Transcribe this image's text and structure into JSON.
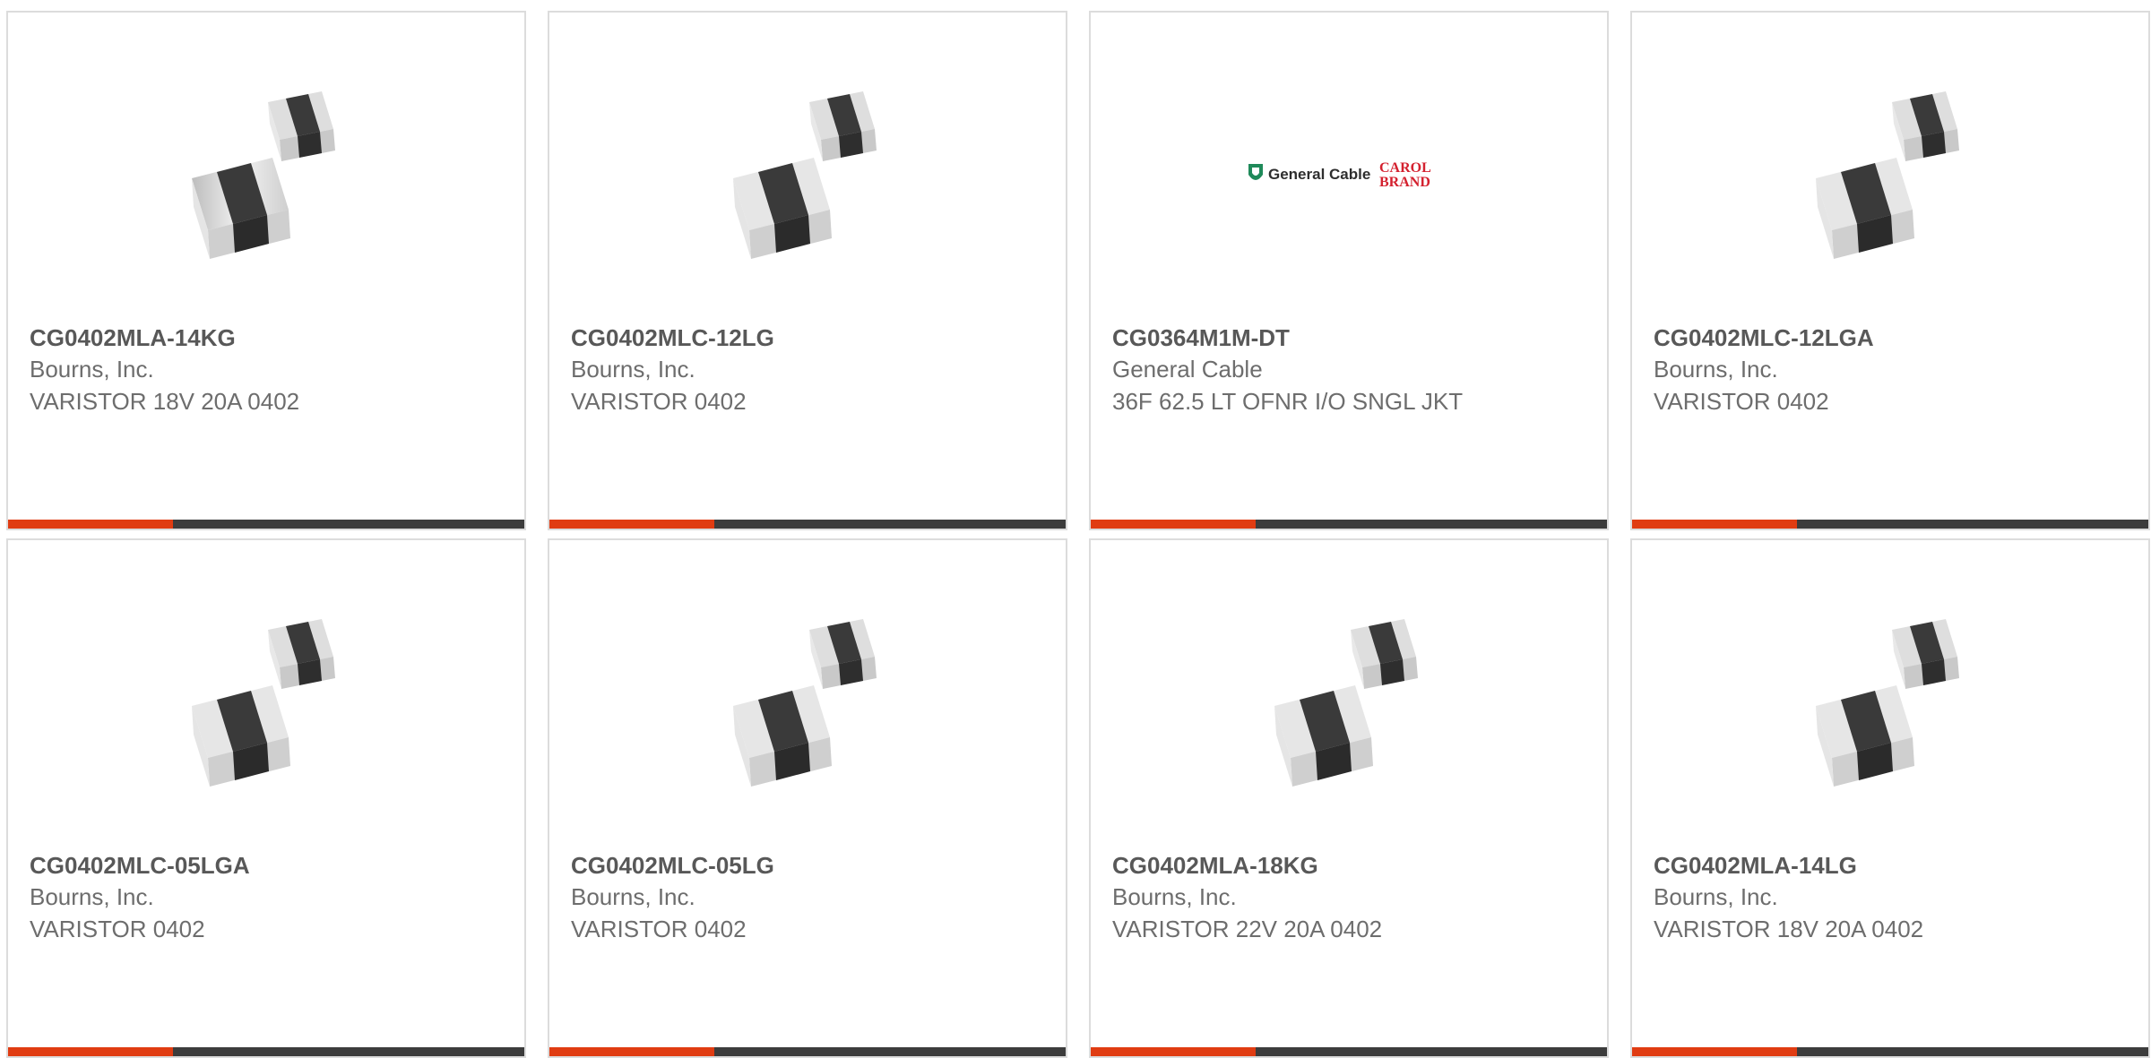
{
  "colors": {
    "accent": "#e03c12",
    "bar": "#3c3c3c",
    "border": "#dcdcdc",
    "part_text": "#585858",
    "body_text": "#6d6d6d"
  },
  "products": [
    {
      "part": "CG0402MLA-14KG",
      "manufacturer": "Bourns, Inc.",
      "description": "VARISTOR 18V 20A 0402",
      "image": "smd-chip-icon"
    },
    {
      "part": "CG0402MLC-12LG",
      "manufacturer": "Bourns, Inc.",
      "description": "VARISTOR 0402",
      "image": "smd-chip-icon"
    },
    {
      "part": "CG0364M1M-DT",
      "manufacturer": "General Cable",
      "description": "36F 62.5 LT OFNR I/O SNGL JKT",
      "image": "general-cable-logo",
      "logo_text": "General Cable",
      "brand_line1": "CAROL",
      "brand_line2": "BRAND"
    },
    {
      "part": "CG0402MLC-12LGA",
      "manufacturer": "Bourns, Inc.",
      "description": "VARISTOR 0402",
      "image": "smd-chip-icon"
    },
    {
      "part": "CG0402MLC-05LGA",
      "manufacturer": "Bourns, Inc.",
      "description": "VARISTOR 0402",
      "image": "smd-chip-icon"
    },
    {
      "part": "CG0402MLC-05LG",
      "manufacturer": "Bourns, Inc.",
      "description": "VARISTOR 0402",
      "image": "smd-chip-icon"
    },
    {
      "part": "CG0402MLA-18KG",
      "manufacturer": "Bourns, Inc.",
      "description": "VARISTOR 22V 20A 0402",
      "image": "smd-chip-icon"
    },
    {
      "part": "CG0402MLA-14LG",
      "manufacturer": "Bourns, Inc.",
      "description": "VARISTOR 18V 20A 0402",
      "image": "smd-chip-icon"
    }
  ]
}
